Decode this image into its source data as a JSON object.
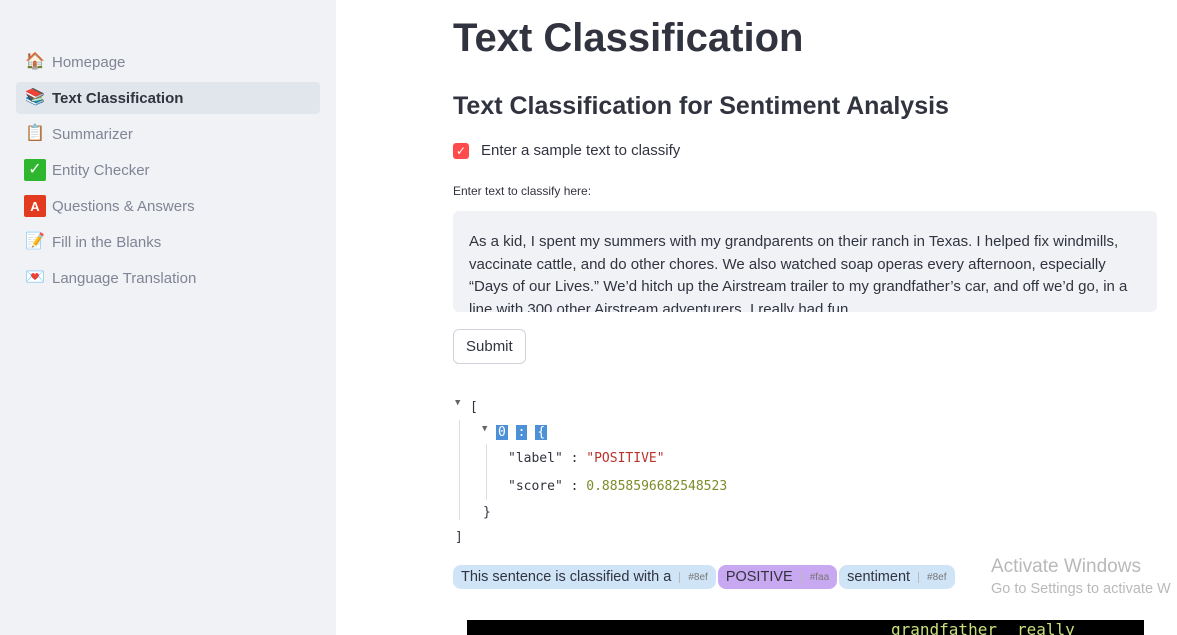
{
  "sidebar": {
    "items": [
      {
        "label": "Homepage",
        "icon": "house-icon",
        "active": false
      },
      {
        "label": "Text Classification",
        "icon": "books-icon",
        "active": true
      },
      {
        "label": "Summarizer",
        "icon": "clipboard-icon",
        "active": false
      },
      {
        "label": "Entity Checker",
        "icon": "check-mark-icon",
        "active": false
      },
      {
        "label": "Questions & Answers",
        "icon": "letter-a-icon",
        "active": false
      },
      {
        "label": "Fill in the Blanks",
        "icon": "memo-icon",
        "active": false
      },
      {
        "label": "Language Translation",
        "icon": "love-letter-icon",
        "active": false
      }
    ]
  },
  "main": {
    "title": "Text Classification",
    "subtitle": "Text Classification for Sentiment Analysis",
    "checkbox_label": "Enter a sample text to classify",
    "checkbox_checked": true,
    "textarea_label": "Enter text to classify here:",
    "textarea_value": "As a kid, I spent my summers with my grandparents on their ranch in Texas. I helped fix windmills, vaccinate cattle, and do other chores. We also watched soap operas every afternoon, especially “Days of our Lives.” We’d hitch up the Airstream trailer to my grandfather’s car, and off we’d go, in a line with 300 other Airstream adventurers. I really had fun.",
    "submit_label": "Submit",
    "json": {
      "open": "[",
      "index": "0",
      "colon": ":",
      "obj_open": "{",
      "label_key": "\"label\"",
      "label_value": "\"POSITIVE\"",
      "score_key": "\"score\"",
      "score_value": "0.8858596682548523",
      "obj_close": "}",
      "close": "]"
    },
    "annotated": [
      {
        "text": "This sentence is classified with a",
        "tag": "#8ef",
        "color": "#cfe4f7"
      },
      {
        "text": "POSITIVE",
        "tag": "#faa",
        "color": "#c9a8f2"
      },
      {
        "text": "sentiment",
        "tag": "#8ef",
        "color": "#cfe4f7"
      }
    ],
    "wordcloud_words": [
      "grandfather",
      "really"
    ]
  },
  "watermark": {
    "line1": "Activate Windows",
    "line2": "Go to Settings to activate W"
  }
}
